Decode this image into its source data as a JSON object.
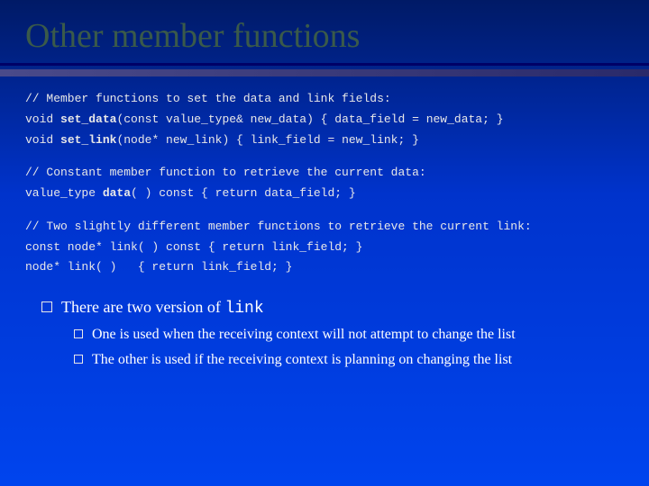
{
  "title": "Other member functions",
  "code": {
    "block1_line1": "// Member functions to set the data and link fields:",
    "block1_line2_a": "void ",
    "block1_line2_b": "set_data",
    "block1_line2_c": "(const value_type& new_data) { data_field = new_data; }",
    "block1_line3_a": "void ",
    "block1_line3_b": "set_link",
    "block1_line3_c": "(node* new_link) { link_field = new_link; }",
    "block2_line1": "// Constant member function to retrieve the current data:",
    "block2_line2_a": "value_type ",
    "block2_line2_b": "data",
    "block2_line2_c": "( ) const { return data_field; }",
    "block3_line1": "// Two slightly different member functions to retrieve the current link:",
    "block3_line2": "const node* link( ) const { return link_field; }",
    "block3_line3": "node* link( )   { return link_field; }"
  },
  "bullets": {
    "main_a": "There are two version of ",
    "main_b": "link",
    "sub1": "One is used when the receiving context will not attempt to change the list",
    "sub2": "The other is used if the receiving context is planning on changing the list"
  }
}
